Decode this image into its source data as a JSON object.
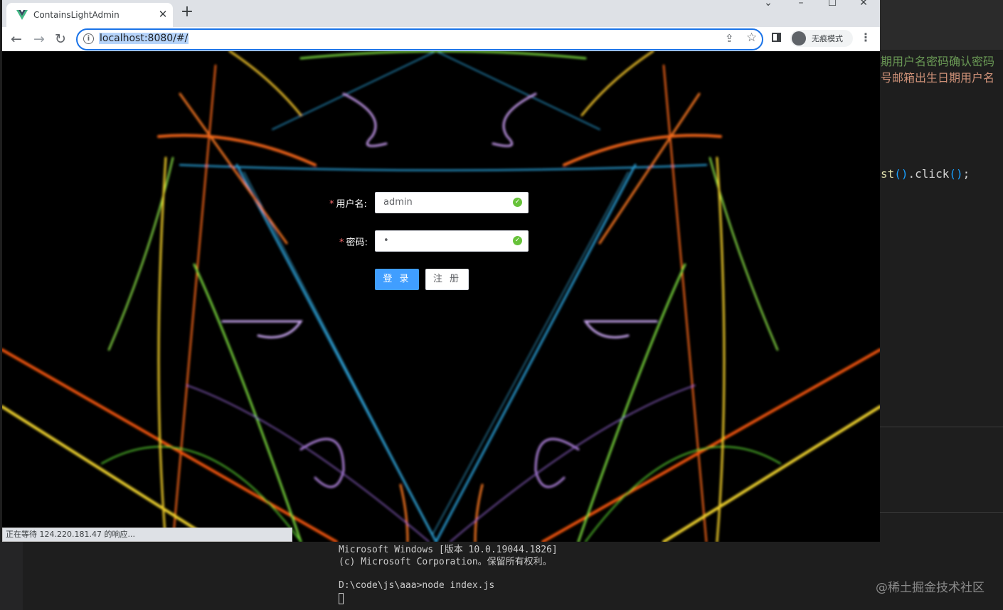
{
  "browser": {
    "tab_title": "ContainsLightAdmin",
    "url": "localhost:8080/#/",
    "profile_label": "无痕模式",
    "status_text": "正在等待 124.220.181.47 的响应..."
  },
  "login_form": {
    "username_label": "用户名:",
    "username_value": "admin",
    "password_label": "密码:",
    "password_value": "•",
    "login_button": "登 录",
    "register_button": "注 册",
    "required_mark": "*"
  },
  "editor": {
    "line1": "期用户名密码确认密码",
    "line2": "号邮箱出生日期用户名",
    "line3_a": "st",
    "line3_b": "()",
    "line3_c": ".click",
    "line3_d": "()",
    "line3_e": ";"
  },
  "terminal": {
    "line1": "Microsoft Windows [版本 10.0.19044.1826]",
    "line2": "(c) Microsoft Corporation。保留所有权利。",
    "line3": "D:\\code\\js\\aaa>node index.js"
  },
  "watermark": "@稀土掘金技术社区",
  "colors": {
    "accent": "#409eff",
    "success": "#67c23a",
    "required": "#f56c6c",
    "omnibox_focus": "#1a73e8"
  }
}
